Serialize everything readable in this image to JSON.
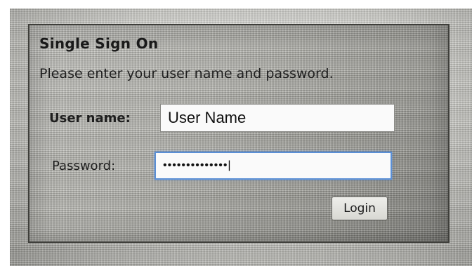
{
  "dialog": {
    "title": "Single Sign On",
    "instructions": "Please enter your user name and password.",
    "username_label": "User name:",
    "username_value": "User Name",
    "password_label": "Password:",
    "password_masked": "••••••••••••••|",
    "login_label": "Login"
  },
  "colors": {
    "focus_border": "#5a8fd6",
    "dialog_border": "#3e3e3a"
  }
}
